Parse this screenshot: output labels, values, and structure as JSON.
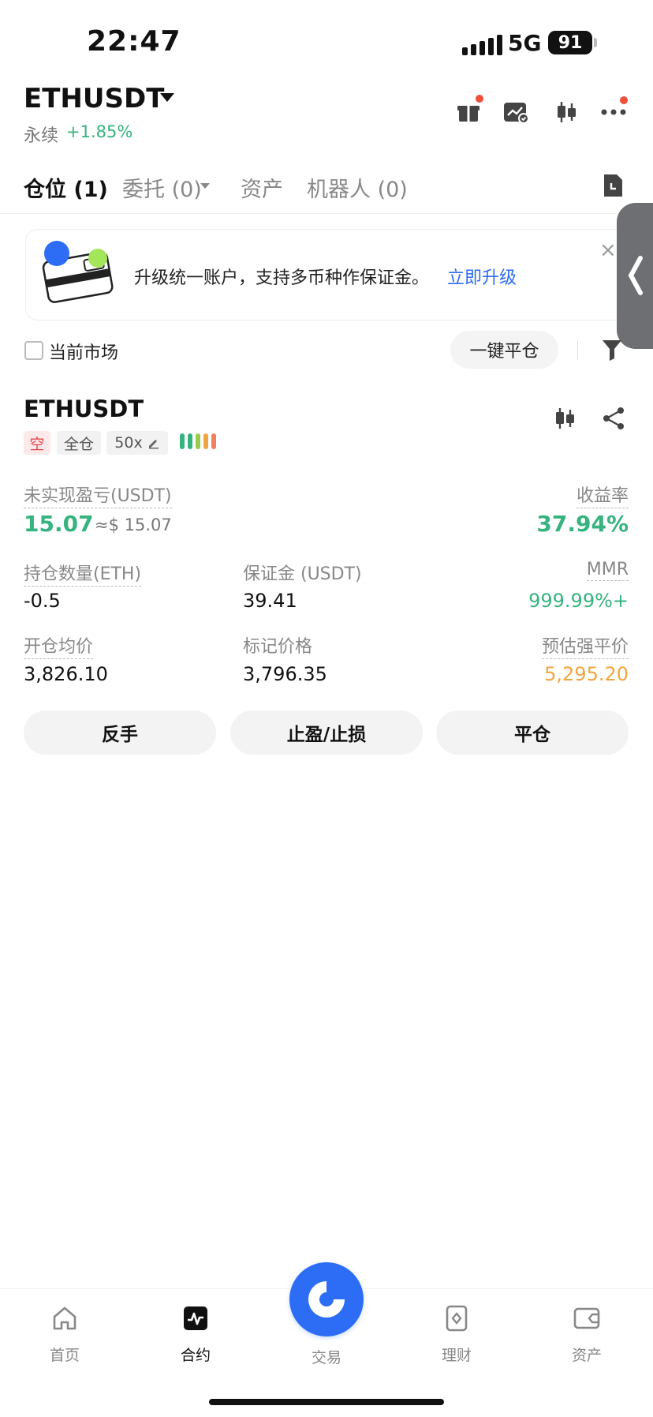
{
  "status_bar": {
    "time": "22:47",
    "network": "5G",
    "battery": "91"
  },
  "header": {
    "symbol": "ETHUSDT",
    "contract_type": "永续",
    "change": "+1.85%"
  },
  "tabs": [
    {
      "label": "仓位 (1)"
    },
    {
      "label": "委托 (0)"
    },
    {
      "label": "资产"
    },
    {
      "label": "机器人 (0)"
    }
  ],
  "banner": {
    "text": "升级统一账户，支持多币种作保证金。",
    "link": "立即升级",
    "close": "×"
  },
  "market_filter": {
    "current_market_label": "当前市场",
    "close_all_label": "一键平仓"
  },
  "position": {
    "symbol": "ETHUSDT",
    "side": "空",
    "margin_mode": "全仓",
    "leverage": "50x",
    "adl_level_colors": [
      "#36b37e",
      "#36b37e",
      "#9acb4c",
      "#f0a640",
      "#f07f5a"
    ],
    "unrealized_pnl_label": "未实现盈亏(USDT)",
    "unrealized_pnl": "15.07",
    "unrealized_pnl_usd": "≈$ 15.07",
    "roe_label": "收益率",
    "roe": "37.94%",
    "size_label": "持仓数量(ETH)",
    "size": "-0.5",
    "margin_label": "保证金 (USDT)",
    "margin": "39.41",
    "mmr_label": "MMR",
    "mmr": "999.99%+",
    "entry_label": "开仓均价",
    "entry": "3,826.10",
    "mark_label": "标记价格",
    "mark": "3,796.35",
    "liq_label": "预估强平价",
    "liq": "5,295.20"
  },
  "actions": {
    "reverse": "反手",
    "tpsl": "止盈/止损",
    "close": "平仓"
  },
  "nav": {
    "home": "首页",
    "contract": "合约",
    "trade": "交易",
    "earn": "理财",
    "assets": "资产"
  },
  "colors": {
    "accent": "#2d6df6",
    "up": "#36b37e",
    "down": "#e5484d",
    "liq": "#f0a640"
  }
}
